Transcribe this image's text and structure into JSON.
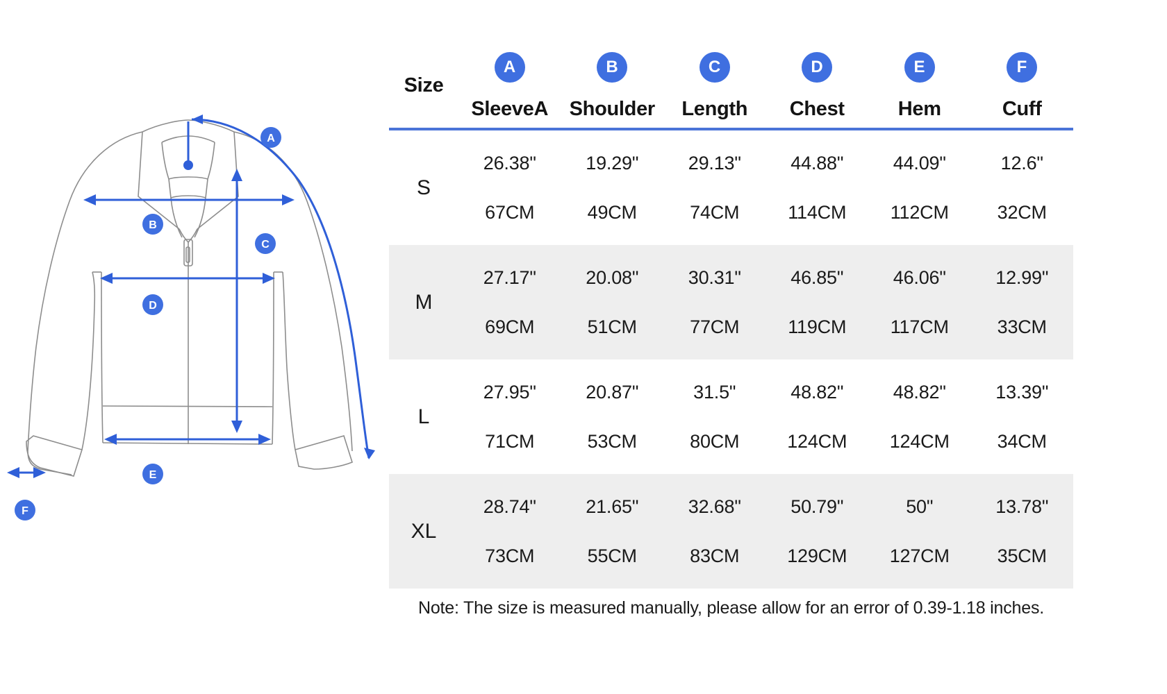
{
  "diagram": {
    "title": "jacket-measurement-diagram",
    "markers": [
      {
        "id": "A",
        "label": "A",
        "measure": "SleeveA"
      },
      {
        "id": "B",
        "label": "B",
        "measure": "Shoulder"
      },
      {
        "id": "C",
        "label": "C",
        "measure": "Length"
      },
      {
        "id": "D",
        "label": "D",
        "measure": "Chest"
      },
      {
        "id": "E",
        "label": "E",
        "measure": "Hem"
      },
      {
        "id": "F",
        "label": "F",
        "measure": "Cuff"
      }
    ],
    "colors": {
      "accent": "#2f5fd8",
      "outline": "#8d8d8d",
      "badge": "#3f6fe0"
    }
  },
  "table": {
    "size_header": "Size",
    "columns": [
      {
        "badge": "A",
        "label": "SleeveA"
      },
      {
        "badge": "B",
        "label": "Shoulder"
      },
      {
        "badge": "C",
        "label": "Length"
      },
      {
        "badge": "D",
        "label": "Chest"
      },
      {
        "badge": "E",
        "label": "Hem"
      },
      {
        "badge": "F",
        "label": "Cuff"
      }
    ],
    "rows": [
      {
        "size": "S",
        "inches": [
          "26.38\"",
          "19.29\"",
          "29.13\"",
          "44.88\"",
          "44.09\"",
          "12.6\""
        ],
        "cm": [
          "67CM",
          "49CM",
          "74CM",
          "114CM",
          "112CM",
          "32CM"
        ]
      },
      {
        "size": "M",
        "inches": [
          "27.17\"",
          "20.08\"",
          "30.31\"",
          "46.85\"",
          "46.06\"",
          "12.99\""
        ],
        "cm": [
          "69CM",
          "51CM",
          "77CM",
          "119CM",
          "117CM",
          "33CM"
        ]
      },
      {
        "size": "L",
        "inches": [
          "27.95\"",
          "20.87\"",
          "31.5\"",
          "48.82\"",
          "48.82\"",
          "13.39\""
        ],
        "cm": [
          "71CM",
          "53CM",
          "80CM",
          "124CM",
          "124CM",
          "34CM"
        ]
      },
      {
        "size": "XL",
        "inches": [
          "28.74\"",
          "21.65\"",
          "32.68\"",
          "50.79\"",
          "50\"",
          "13.78\""
        ],
        "cm": [
          "73CM",
          "55CM",
          "83CM",
          "129CM",
          "127CM",
          "35CM"
        ]
      }
    ],
    "note": "Note: The size is measured manually, please allow for an error of 0.39-1.18 inches."
  }
}
